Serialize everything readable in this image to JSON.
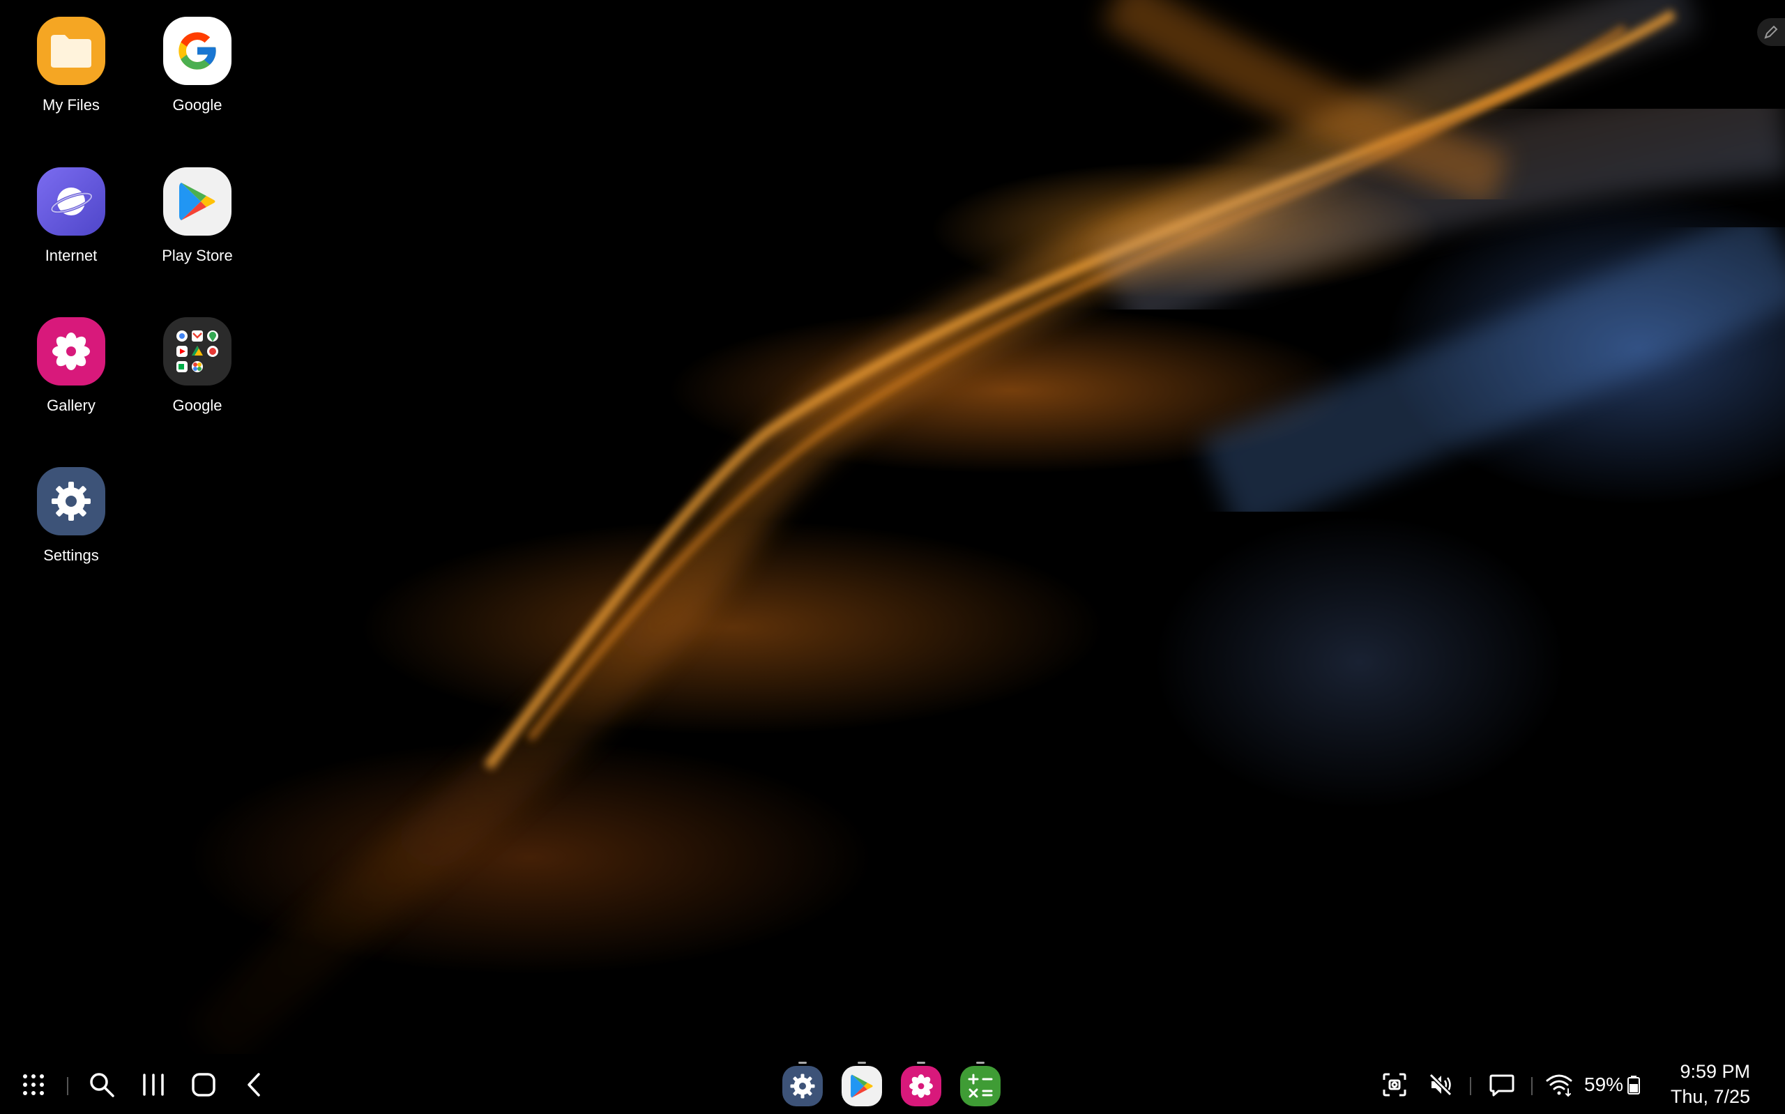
{
  "home_apps": [
    {
      "name": "my-files",
      "label": "My Files",
      "icon": "folder-icon",
      "color": "#f5a623"
    },
    {
      "name": "google",
      "label": "Google",
      "icon": "google-g-icon",
      "color": "#ffffff"
    },
    {
      "name": "internet",
      "label": "Internet",
      "icon": "internet-planet-icon",
      "color": "#6c5ce7"
    },
    {
      "name": "play-store",
      "label": "Play Store",
      "icon": "play-store-icon",
      "color": "#f1f1f1"
    },
    {
      "name": "gallery",
      "label": "Gallery",
      "icon": "gallery-flower-icon",
      "color": "#d8197b"
    },
    {
      "name": "google-folder",
      "label": "Google",
      "icon": "google-apps-folder-icon",
      "color": "#2b2b2b"
    },
    {
      "name": "settings",
      "label": "Settings",
      "icon": "settings-gear-icon",
      "color": "#3d5378"
    }
  ],
  "taskbar": {
    "left_buttons": [
      "app-drawer-icon",
      "search-icon",
      "recents-icon",
      "home-icon",
      "back-icon"
    ],
    "dock_apps": [
      {
        "name": "settings",
        "icon": "settings-gear-icon",
        "color": "#3d5378"
      },
      {
        "name": "play-store",
        "icon": "play-store-icon",
        "color": "#f1f1f1"
      },
      {
        "name": "gallery",
        "icon": "gallery-flower-icon",
        "color": "#d8197b"
      },
      {
        "name": "calculator",
        "icon": "calculator-icon",
        "color": "#3f9c35"
      }
    ],
    "status": {
      "icons": [
        "screenshot-icon",
        "mute-icon",
        "message-icon",
        "wifi-icon",
        "battery-icon"
      ],
      "battery_percent": "59%",
      "time": "9:59 PM",
      "date": "Thu, 7/25"
    }
  },
  "colors": {
    "wallpaper_orange": "#e8861c",
    "wallpaper_blue": "#5a8fdc",
    "taskbar_bg": "#000000"
  }
}
